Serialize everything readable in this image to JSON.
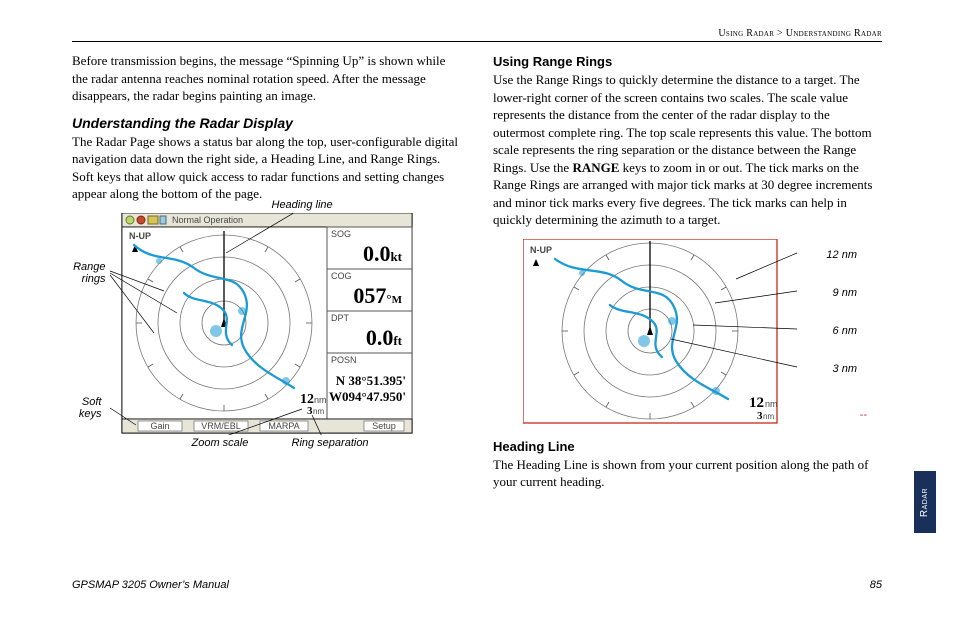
{
  "breadcrumb": {
    "left": "Using Radar",
    "sep": " > ",
    "right": "Understanding Radar"
  },
  "col1": {
    "intro": "Before transmission begins, the message “Spinning Up” is shown while the radar antenna reaches nominal rotation speed. After the message disappears, the radar begins painting an image.",
    "h1": "Understanding the Radar Display",
    "p1": "The Radar Page shows a status bar along the top, user-configurable digital navigation data down the right side, a Heading Line, and Range Rings. Soft keys that allow quick access to radar functions and setting changes appear along the bottom of the page."
  },
  "fig1": {
    "heading_line": "Heading line",
    "range_rings": "Range rings",
    "soft_keys": "Soft keys",
    "zoom_scale": "Zoom scale",
    "ring_separation": "Ring separation",
    "status_bar": "Normal Operation",
    "nup": "N-UP",
    "sog_label": "SOG",
    "sog_value": "0.0",
    "sog_unit": "kt",
    "cog_label": "COG",
    "cog_value": "057",
    "cog_unit": "M",
    "cog_deg": "°",
    "dpt_label": "DPT",
    "dpt_value": "0.0",
    "dpt_unit": "ft",
    "posn_label": "POSN",
    "posn_lat": "N  38°51.395'",
    "posn_lon": "W094°47.950'",
    "scale_zoom": "12",
    "scale_zoom_unit": "nm",
    "scale_ring": "3",
    "scale_ring_unit": "nm",
    "softkeys": {
      "gain": "Gain",
      "vrm": "VRM/EBL",
      "marpa": "MARPA",
      "setup": "Setup"
    }
  },
  "col2": {
    "h1": "Using Range Rings",
    "p1a": "Use the Range Rings to quickly determine the distance to a target. The lower-right corner of the screen contains two scales. The scale value represents the distance from the center of the radar display to the outermost complete ring. The top scale represents this value. The bottom scale represents the ring separation or the distance between the Range Rings.  Use the ",
    "range_word": "RANGE",
    "p1b": " keys to zoom in or out. The tick marks on the Range Rings are arranged with major tick marks at 30 degree increments and minor tick marks every five degrees. The tick marks can help in quickly determining the azimuth to a target.",
    "h2": "Heading Line",
    "p2": "The Heading Line is shown from your current position along the path of your current heading."
  },
  "fig2": {
    "r12": "12 nm",
    "r9": "9 nm",
    "r6": "6 nm",
    "r3": "3 nm",
    "nup": "N-UP",
    "scale_zoom": "12",
    "scale_zoom_unit": "nm",
    "scale_ring": "3",
    "scale_ring_unit": "nm",
    "dashes": "--"
  },
  "side_tab": "Radar",
  "footer": {
    "left": "GPSMAP 3205 Owner’s Manual",
    "page": "85"
  }
}
